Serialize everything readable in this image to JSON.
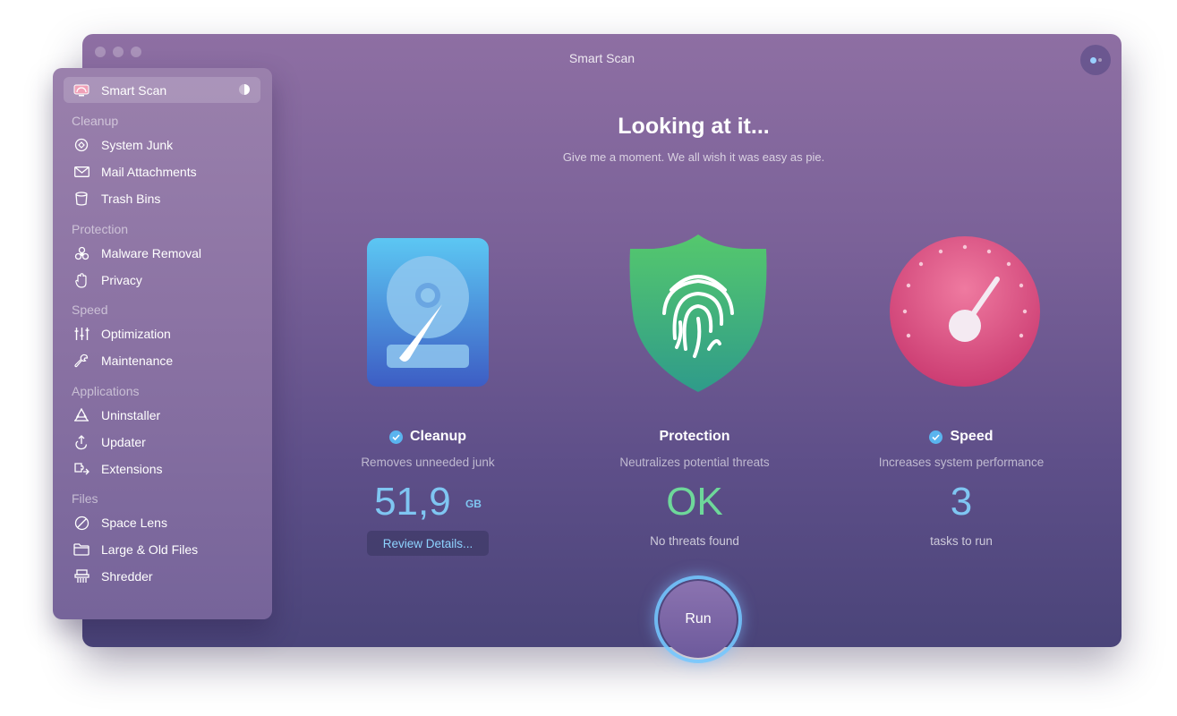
{
  "window": {
    "title": "Smart Scan"
  },
  "sidebar": {
    "active": {
      "label": "Smart Scan",
      "icon": "smart-scan-icon"
    },
    "sections": [
      {
        "label": "Cleanup",
        "items": [
          {
            "label": "System Junk",
            "icon": "system-junk-icon"
          },
          {
            "label": "Mail Attachments",
            "icon": "mail-icon"
          },
          {
            "label": "Trash Bins",
            "icon": "trash-icon"
          }
        ]
      },
      {
        "label": "Protection",
        "items": [
          {
            "label": "Malware Removal",
            "icon": "biohazard-icon"
          },
          {
            "label": "Privacy",
            "icon": "hand-icon"
          }
        ]
      },
      {
        "label": "Speed",
        "items": [
          {
            "label": "Optimization",
            "icon": "sliders-icon"
          },
          {
            "label": "Maintenance",
            "icon": "wrench-icon"
          }
        ]
      },
      {
        "label": "Applications",
        "items": [
          {
            "label": "Uninstaller",
            "icon": "uninstaller-icon"
          },
          {
            "label": "Updater",
            "icon": "updater-icon"
          },
          {
            "label": "Extensions",
            "icon": "extensions-icon"
          }
        ]
      },
      {
        "label": "Files",
        "items": [
          {
            "label": "Space Lens",
            "icon": "space-lens-icon"
          },
          {
            "label": "Large & Old Files",
            "icon": "folder-icon"
          },
          {
            "label": "Shredder",
            "icon": "shredder-icon"
          }
        ]
      }
    ]
  },
  "main": {
    "title": "Looking at it...",
    "subtitle": "Give me a moment. We all wish it was easy as pie.",
    "cleanup": {
      "title": "Cleanup",
      "description": "Removes unneeded junk",
      "value": "51,9",
      "unit": "GB",
      "button": "Review Details...",
      "checked": true
    },
    "protection": {
      "title": "Protection",
      "description": "Neutralizes potential threats",
      "value": "OK",
      "note": "No threats found",
      "checked": false
    },
    "speed": {
      "title": "Speed",
      "description": "Increases system performance",
      "value": "3",
      "note": "tasks to run",
      "checked": true
    },
    "run_label": "Run"
  },
  "colors": {
    "value_blue": "#7fc6f2",
    "value_green": "#6ed89a",
    "check_blue": "#5ab4ef",
    "link_blue": "#8ed3ff"
  }
}
